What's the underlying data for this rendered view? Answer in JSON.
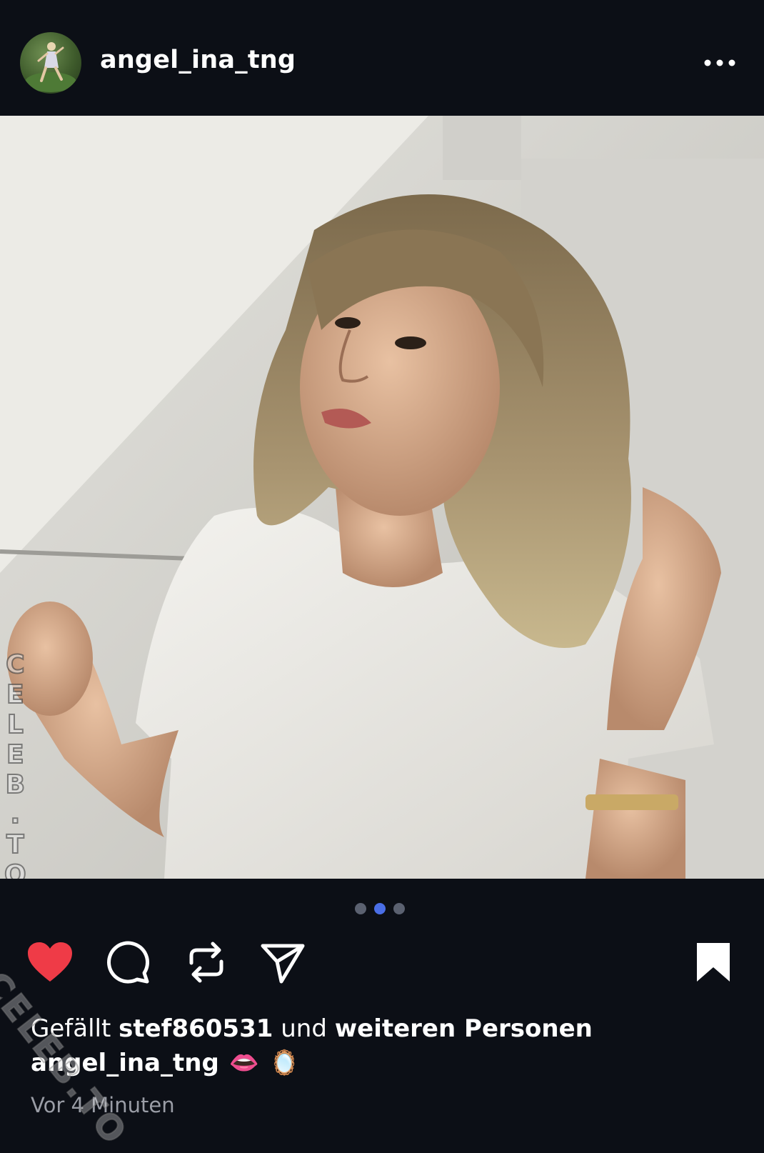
{
  "post": {
    "username": "angel_ina_tng",
    "more_icon": "ellipsis-icon",
    "photo_alt": "",
    "carousel": {
      "count": 3,
      "active_index": 1
    },
    "watermark": "CELEB.TO",
    "likes": {
      "prefix": "Gefällt",
      "user": "stef860531",
      "middle": "und",
      "suffix": "weiteren Personen"
    },
    "caption": {
      "user": "angel_ina_tng",
      "emojis": [
        "👄",
        "🪞"
      ]
    },
    "timestamp": "Vor 4 Minuten"
  },
  "icons": {
    "like": "heart-icon",
    "comment": "comment-icon",
    "repost": "repost-icon",
    "share": "send-icon",
    "save": "bookmark-icon"
  },
  "colors": {
    "background": "#0c0f16",
    "like": "#ef3b47",
    "carousel_active": "#4a6ee6",
    "carousel_inactive": "#5b6170",
    "timestamp": "#9a9da6"
  }
}
